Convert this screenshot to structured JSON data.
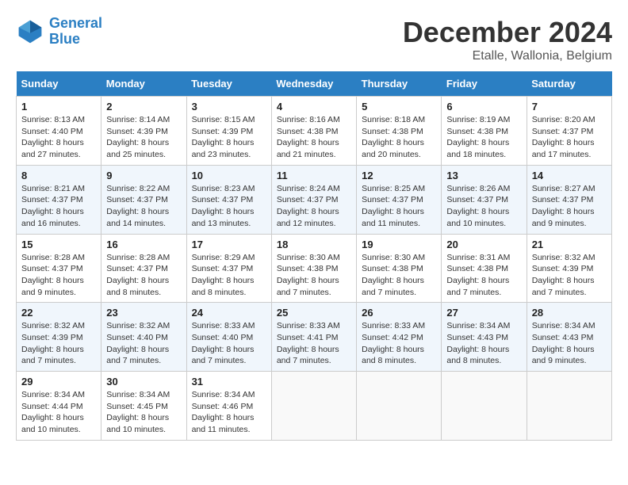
{
  "logo": {
    "line1": "General",
    "line2": "Blue"
  },
  "title": "December 2024",
  "subtitle": "Etalle, Wallonia, Belgium",
  "weekdays": [
    "Sunday",
    "Monday",
    "Tuesday",
    "Wednesday",
    "Thursday",
    "Friday",
    "Saturday"
  ],
  "weeks": [
    [
      {
        "day": "1",
        "info": "Sunrise: 8:13 AM\nSunset: 4:40 PM\nDaylight: 8 hours\nand 27 minutes."
      },
      {
        "day": "2",
        "info": "Sunrise: 8:14 AM\nSunset: 4:39 PM\nDaylight: 8 hours\nand 25 minutes."
      },
      {
        "day": "3",
        "info": "Sunrise: 8:15 AM\nSunset: 4:39 PM\nDaylight: 8 hours\nand 23 minutes."
      },
      {
        "day": "4",
        "info": "Sunrise: 8:16 AM\nSunset: 4:38 PM\nDaylight: 8 hours\nand 21 minutes."
      },
      {
        "day": "5",
        "info": "Sunrise: 8:18 AM\nSunset: 4:38 PM\nDaylight: 8 hours\nand 20 minutes."
      },
      {
        "day": "6",
        "info": "Sunrise: 8:19 AM\nSunset: 4:38 PM\nDaylight: 8 hours\nand 18 minutes."
      },
      {
        "day": "7",
        "info": "Sunrise: 8:20 AM\nSunset: 4:37 PM\nDaylight: 8 hours\nand 17 minutes."
      }
    ],
    [
      {
        "day": "8",
        "info": "Sunrise: 8:21 AM\nSunset: 4:37 PM\nDaylight: 8 hours\nand 16 minutes."
      },
      {
        "day": "9",
        "info": "Sunrise: 8:22 AM\nSunset: 4:37 PM\nDaylight: 8 hours\nand 14 minutes."
      },
      {
        "day": "10",
        "info": "Sunrise: 8:23 AM\nSunset: 4:37 PM\nDaylight: 8 hours\nand 13 minutes."
      },
      {
        "day": "11",
        "info": "Sunrise: 8:24 AM\nSunset: 4:37 PM\nDaylight: 8 hours\nand 12 minutes."
      },
      {
        "day": "12",
        "info": "Sunrise: 8:25 AM\nSunset: 4:37 PM\nDaylight: 8 hours\nand 11 minutes."
      },
      {
        "day": "13",
        "info": "Sunrise: 8:26 AM\nSunset: 4:37 PM\nDaylight: 8 hours\nand 10 minutes."
      },
      {
        "day": "14",
        "info": "Sunrise: 8:27 AM\nSunset: 4:37 PM\nDaylight: 8 hours\nand 9 minutes."
      }
    ],
    [
      {
        "day": "15",
        "info": "Sunrise: 8:28 AM\nSunset: 4:37 PM\nDaylight: 8 hours\nand 9 minutes."
      },
      {
        "day": "16",
        "info": "Sunrise: 8:28 AM\nSunset: 4:37 PM\nDaylight: 8 hours\nand 8 minutes."
      },
      {
        "day": "17",
        "info": "Sunrise: 8:29 AM\nSunset: 4:37 PM\nDaylight: 8 hours\nand 8 minutes."
      },
      {
        "day": "18",
        "info": "Sunrise: 8:30 AM\nSunset: 4:38 PM\nDaylight: 8 hours\nand 7 minutes."
      },
      {
        "day": "19",
        "info": "Sunrise: 8:30 AM\nSunset: 4:38 PM\nDaylight: 8 hours\nand 7 minutes."
      },
      {
        "day": "20",
        "info": "Sunrise: 8:31 AM\nSunset: 4:38 PM\nDaylight: 8 hours\nand 7 minutes."
      },
      {
        "day": "21",
        "info": "Sunrise: 8:32 AM\nSunset: 4:39 PM\nDaylight: 8 hours\nand 7 minutes."
      }
    ],
    [
      {
        "day": "22",
        "info": "Sunrise: 8:32 AM\nSunset: 4:39 PM\nDaylight: 8 hours\nand 7 minutes."
      },
      {
        "day": "23",
        "info": "Sunrise: 8:32 AM\nSunset: 4:40 PM\nDaylight: 8 hours\nand 7 minutes."
      },
      {
        "day": "24",
        "info": "Sunrise: 8:33 AM\nSunset: 4:40 PM\nDaylight: 8 hours\nand 7 minutes."
      },
      {
        "day": "25",
        "info": "Sunrise: 8:33 AM\nSunset: 4:41 PM\nDaylight: 8 hours\nand 7 minutes."
      },
      {
        "day": "26",
        "info": "Sunrise: 8:33 AM\nSunset: 4:42 PM\nDaylight: 8 hours\nand 8 minutes."
      },
      {
        "day": "27",
        "info": "Sunrise: 8:34 AM\nSunset: 4:43 PM\nDaylight: 8 hours\nand 8 minutes."
      },
      {
        "day": "28",
        "info": "Sunrise: 8:34 AM\nSunset: 4:43 PM\nDaylight: 8 hours\nand 9 minutes."
      }
    ],
    [
      {
        "day": "29",
        "info": "Sunrise: 8:34 AM\nSunset: 4:44 PM\nDaylight: 8 hours\nand 10 minutes."
      },
      {
        "day": "30",
        "info": "Sunrise: 8:34 AM\nSunset: 4:45 PM\nDaylight: 8 hours\nand 10 minutes."
      },
      {
        "day": "31",
        "info": "Sunrise: 8:34 AM\nSunset: 4:46 PM\nDaylight: 8 hours\nand 11 minutes."
      },
      {
        "day": "",
        "info": ""
      },
      {
        "day": "",
        "info": ""
      },
      {
        "day": "",
        "info": ""
      },
      {
        "day": "",
        "info": ""
      }
    ]
  ]
}
